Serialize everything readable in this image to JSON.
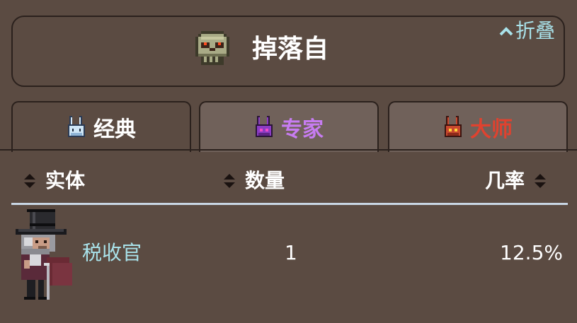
{
  "header": {
    "title": "掉落自",
    "collapse_label": "折叠"
  },
  "tabs": [
    {
      "label": "经典",
      "color": "#ffffff"
    },
    {
      "label": "专家",
      "color": "#c77cf2"
    },
    {
      "label": "大师",
      "color": "#e0422f"
    }
  ],
  "table": {
    "columns": [
      "实体",
      "数量",
      "几率"
    ],
    "rows": [
      {
        "entity": "税收官",
        "quantity": "1",
        "rate": "12.5%"
      }
    ]
  },
  "colors": {
    "background": "#5b4b42",
    "border": "#2b211d",
    "link": "#a9e2ea",
    "expert": "#c77cf2",
    "master": "#e0422f"
  }
}
